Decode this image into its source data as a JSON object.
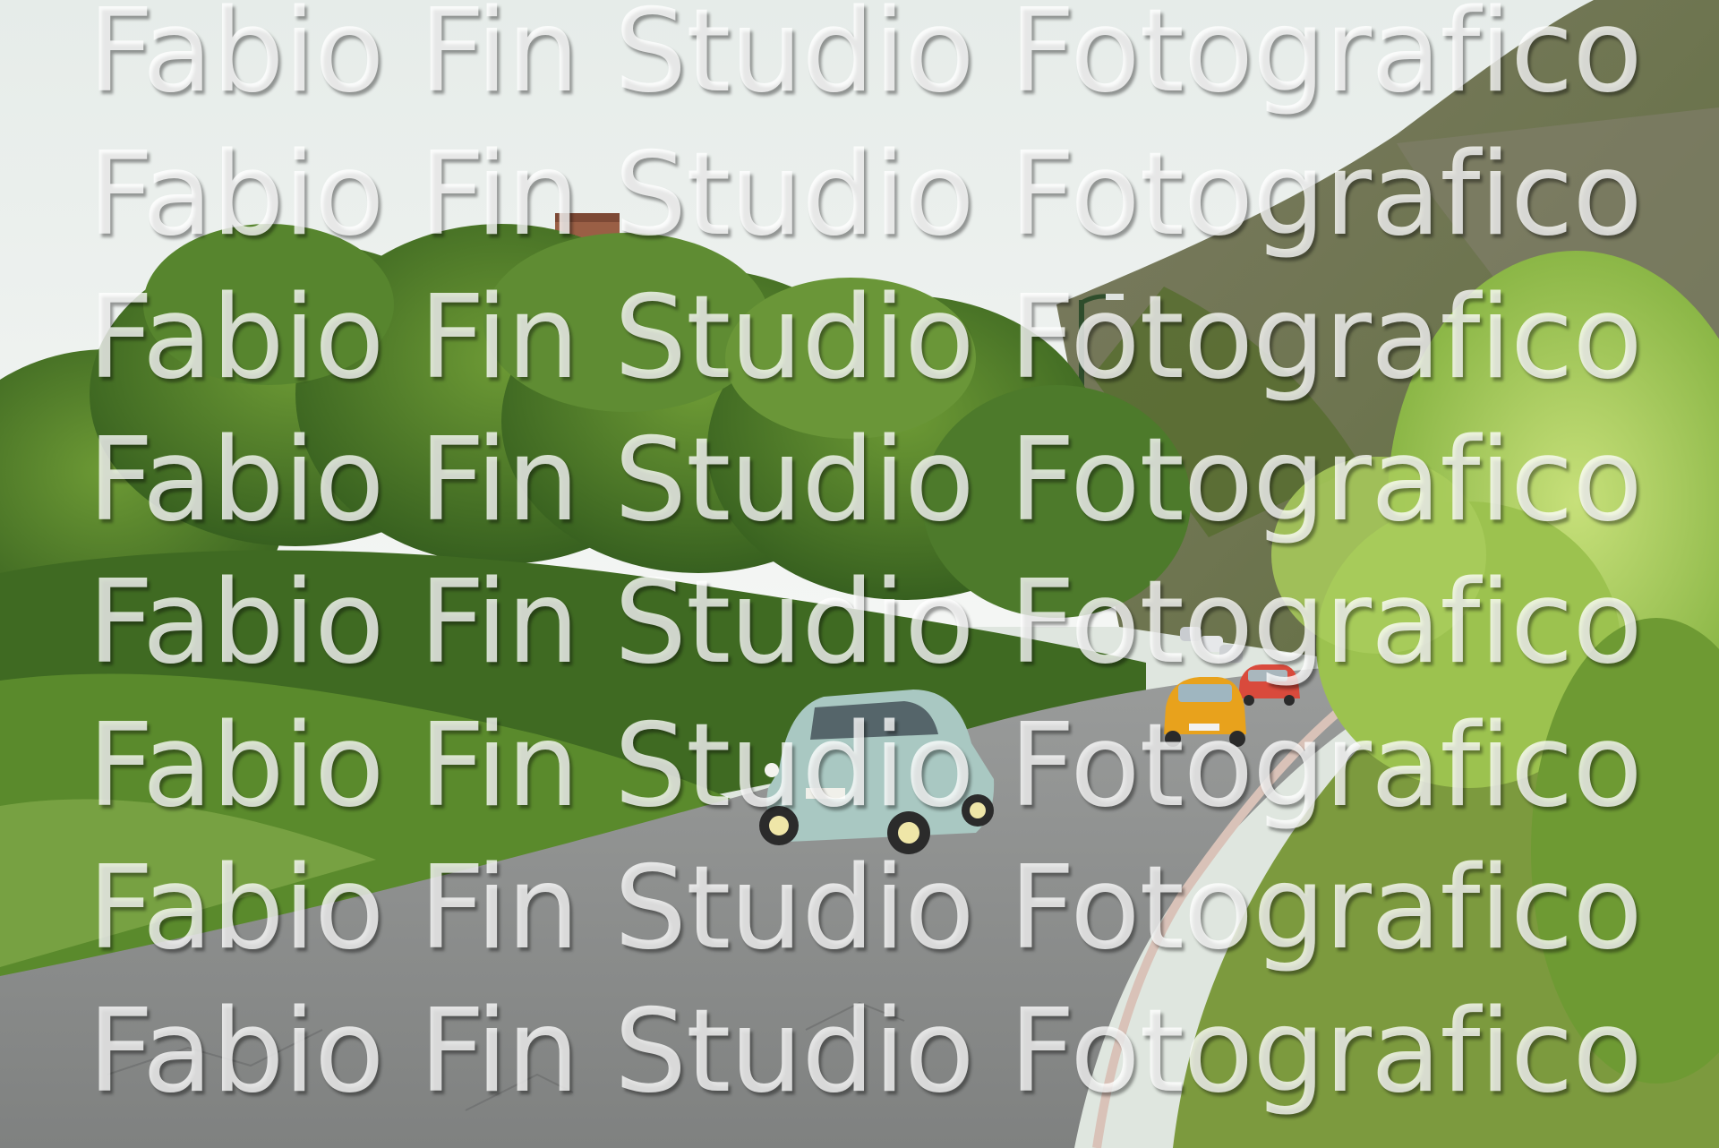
{
  "photo": {
    "subject": "vintage-fiat-500-convoy",
    "colors": {
      "sky": "#eef1ef",
      "foliage_dark": "#3f6a22",
      "foliage_light": "#8fbf4a",
      "road": "#8b8d8c",
      "car_lead": "#a9c8c2",
      "car_second": "#e8a21c",
      "car_third": "#d94a3c"
    }
  },
  "watermark": {
    "lines": [
      "Fabio Fin Studio Fotografico",
      "Fabio Fin Studio Fotografico",
      "Fabio Fin Studio Fotografico",
      "Fabio Fin Studio Fotografico",
      "Fabio Fin Studio Fotografico",
      "Fabio Fin Studio Fotografico",
      "Fabio Fin Studio Fotografico",
      "Fabio Fin Studio Fotografico"
    ]
  }
}
